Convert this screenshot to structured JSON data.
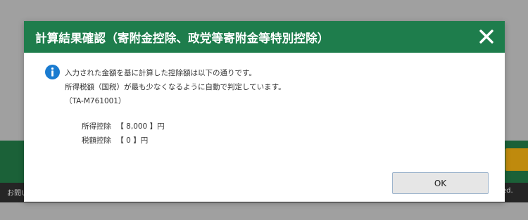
{
  "background": {
    "footer_left_text": "お問い",
    "footer_right_text": "rved."
  },
  "dialog": {
    "title": "計算結果確認（寄附金控除、政党等寄附金等特別控除）",
    "message_lines": [
      "入力された金額を基に計算した控除額は以下の通りです。",
      "所得税額（国税）が最も少なくなるように自動で判定しています。",
      "（TA-M761001）"
    ],
    "amounts": [
      {
        "label": "所得控除",
        "value": "【 8,000 】円"
      },
      {
        "label": "税額控除",
        "value": "【 0 】円"
      }
    ],
    "ok_label": "OK"
  },
  "colors": {
    "header": "#1e7d4c",
    "info_icon": "#1a7bd0",
    "overlay": "#b3b3b3"
  }
}
